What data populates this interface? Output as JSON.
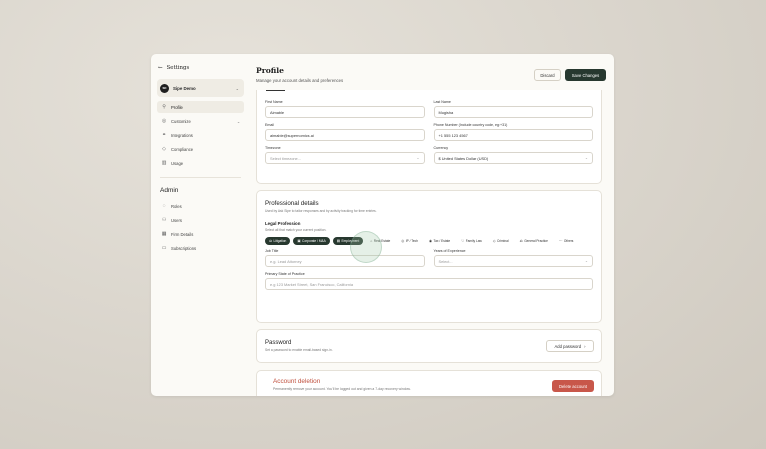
{
  "sidebar": {
    "back_label": "Settings",
    "org": {
      "initials": "SD",
      "name": "Sipe Demo"
    },
    "items": [
      {
        "label": "Profile",
        "icon": "person-icon"
      },
      {
        "label": "Customize",
        "icon": "customize-icon"
      },
      {
        "label": "Integrations",
        "icon": "plug-icon"
      },
      {
        "label": "Compliance",
        "icon": "shield-icon"
      },
      {
        "label": "Usage",
        "icon": "chart-icon"
      }
    ],
    "admin_title": "Admin",
    "admin_items": [
      {
        "label": "Roles",
        "icon": "roles-icon"
      },
      {
        "label": "Users",
        "icon": "users-icon"
      },
      {
        "label": "Firm Details",
        "icon": "building-icon"
      },
      {
        "label": "Subscriptions",
        "icon": "card-icon"
      }
    ]
  },
  "header": {
    "title": "Profile",
    "subtitle": "Manage your account details and preferences",
    "discard_label": "Discard",
    "save_label": "Save Changes"
  },
  "personal": {
    "first_name_label": "First Name",
    "first_name": "Aimable",
    "last_name_label": "Last Name",
    "last_name": "Mugisha",
    "email_label": "Email",
    "email": "aimable@supernomics.ai",
    "phone_label": "Phone Number (Include country code, eg:+31)",
    "phone": "+1 555 123 4567",
    "timezone_label": "Timezone",
    "timezone_placeholder": "Select timezone...",
    "currency_label": "Currency",
    "currency": "$ United States Dollar (USD)"
  },
  "professional": {
    "title": "Professional details",
    "subtitle": "Used by Ask Sipe to tailor responses and by activity tracking for time entries.",
    "legal_title": "Legal Profession",
    "legal_sub": "Select all that match your current position.",
    "chips": [
      {
        "label": "Litigation",
        "icon": "gavel-icon",
        "selected": true
      },
      {
        "label": "Corporate / M&A",
        "icon": "briefcase-icon",
        "selected": true
      },
      {
        "label": "Employment",
        "icon": "badge-icon",
        "selected": true
      },
      {
        "label": "Real Estate",
        "icon": "house-icon",
        "selected": false
      },
      {
        "label": "IP / Tech",
        "icon": "bulb-icon",
        "selected": false
      },
      {
        "label": "Tax / Estate",
        "icon": "coin-icon",
        "selected": false
      },
      {
        "label": "Family Law",
        "icon": "heart-icon",
        "selected": false
      },
      {
        "label": "Criminal",
        "icon": "shield-icon",
        "selected": false
      },
      {
        "label": "General Practice",
        "icon": "scale-icon",
        "selected": false
      },
      {
        "label": "Others",
        "icon": "dots-icon",
        "selected": false
      }
    ],
    "job_title_label": "Job Title",
    "job_title_placeholder": "e.g. Lead Attorney",
    "years_label": "Years of Experience",
    "years_placeholder": "Select...",
    "state_label": "Primary State of Practice",
    "state_placeholder": "e.g 123 Market Street, San Francisco, California"
  },
  "password": {
    "title": "Password",
    "subtitle": "Set a password to enable email-based sign-in.",
    "button_label": "Add password"
  },
  "deletion": {
    "title": "Account deletion",
    "subtitle": "Permanently remove your account. You'll be logged out and given a 7-day recovery window.",
    "button_label": "Delete account"
  }
}
